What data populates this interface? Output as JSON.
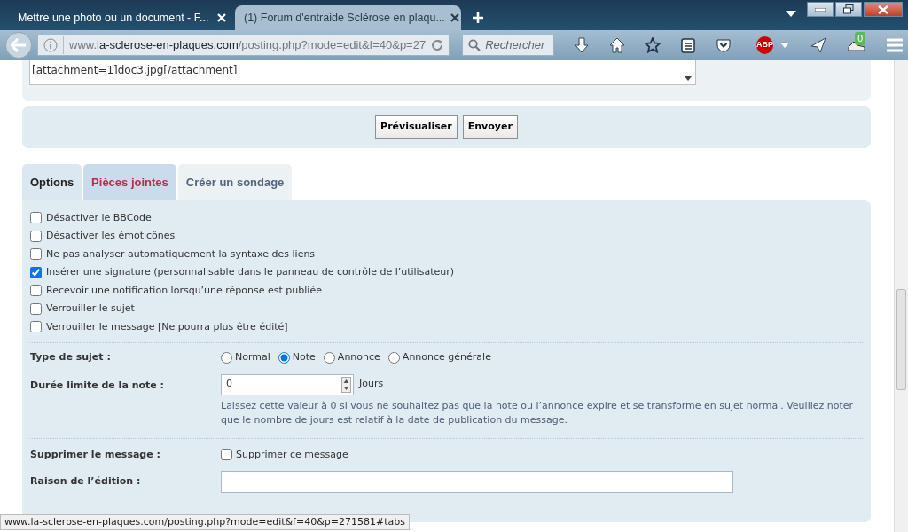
{
  "browser": {
    "tabs": [
      {
        "title": "Mettre une photo ou un document - F...",
        "selected": false
      },
      {
        "title": "(1) Forum d'entraide Sclérose en plaqu...",
        "selected": true
      }
    ],
    "address": {
      "prefix": "www.",
      "host": "la-sclerose-en-plaques.com",
      "path": "/posting.php?mode=edit&f=40&p=27"
    },
    "search": {
      "placeholder": "Rechercher"
    },
    "adblock_label": "ABP",
    "badge_count": "0"
  },
  "editor": {
    "text": "[attachment=1]doc3.jpg[/attachment]"
  },
  "buttons": [
    "Prévisualiser",
    "Envoyer"
  ],
  "tabs": [
    {
      "label": "Options",
      "selected": true,
      "highlighted": false
    },
    {
      "label": "Pièces jointes",
      "selected": false,
      "highlighted": true
    },
    {
      "label": "Créer un sondage",
      "selected": false,
      "highlighted": false
    }
  ],
  "options": [
    {
      "label": "Désactiver le BBCode",
      "checked": false
    },
    {
      "label": "Désactiver les émoticônes",
      "checked": false
    },
    {
      "label": "Ne pas analyser automatiquement la syntaxe des liens",
      "checked": false
    },
    {
      "label": "Insérer une signature (personnalisable dans le panneau de contrôle de l’utilisateur)",
      "checked": true
    },
    {
      "label": "Recevoir une notification lorsqu’une réponse est publiée",
      "checked": false
    },
    {
      "label": "Verrouiller le sujet",
      "checked": false
    },
    {
      "label": "Verrouiller le message [Ne pourra plus être édité]",
      "checked": false
    }
  ],
  "topic_type": {
    "label": "Type de sujet :",
    "choices": [
      {
        "label": "Normal",
        "selected": false
      },
      {
        "label": "Note",
        "selected": true
      },
      {
        "label": "Annonce",
        "selected": false
      },
      {
        "label": "Annonce générale",
        "selected": false
      }
    ]
  },
  "duration": {
    "label": "Durée limite de la note :",
    "value": "0",
    "unit": "Jours",
    "hint": "Laissez cette valeur à 0 si vous ne souhaitez pas que la note ou l’annonce expire et se transforme en sujet normal. Veuillez noter que le nombre de jours est relatif à la date de publication du message."
  },
  "delete": {
    "label": "Supprimer le message :",
    "option": "Supprimer ce message",
    "checked": false
  },
  "edit_reason": {
    "label": "Raison de l’édition :"
  },
  "status_bar": "www.la-sclerose-en-plaques.com/posting.php?mode=edit&f=40&p=271581#tabs"
}
